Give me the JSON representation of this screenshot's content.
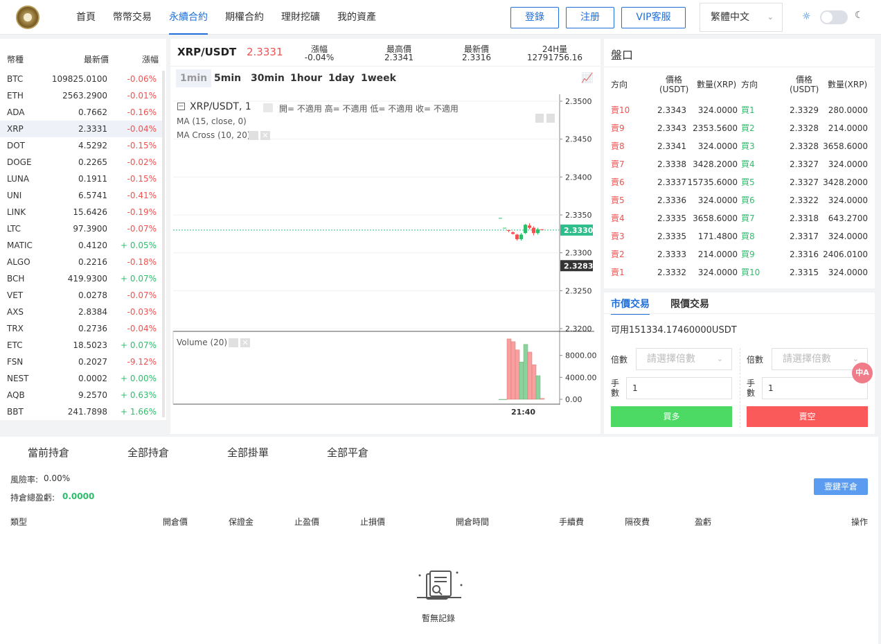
{
  "nav": {
    "items": [
      "首頁",
      "幣幣交易",
      "永續合約",
      "期權合約",
      "理財挖礦",
      "我的資產"
    ],
    "active_index": 2,
    "login": "登錄",
    "register": "注册",
    "vip": "VIP客服",
    "language": "繁體中文"
  },
  "coins": {
    "headers": [
      "幣種",
      "最新價",
      "漲幅"
    ],
    "rows": [
      {
        "sym": "BTC",
        "price": "109825.0100",
        "chg": "-0.06%",
        "dir": "neg"
      },
      {
        "sym": "ETH",
        "price": "2563.2900",
        "chg": "-0.01%",
        "dir": "neg"
      },
      {
        "sym": "ADA",
        "price": "0.7662",
        "chg": "-0.16%",
        "dir": "neg"
      },
      {
        "sym": "XRP",
        "price": "2.3331",
        "chg": "-0.04%",
        "dir": "neg"
      },
      {
        "sym": "DOT",
        "price": "4.5292",
        "chg": "-0.15%",
        "dir": "neg"
      },
      {
        "sym": "DOGE",
        "price": "0.2265",
        "chg": "-0.02%",
        "dir": "neg"
      },
      {
        "sym": "LUNA",
        "price": "0.1911",
        "chg": "-0.15%",
        "dir": "neg"
      },
      {
        "sym": "UNI",
        "price": "6.5741",
        "chg": "-0.41%",
        "dir": "neg"
      },
      {
        "sym": "LINK",
        "price": "15.6426",
        "chg": "-0.19%",
        "dir": "neg"
      },
      {
        "sym": "LTC",
        "price": "97.3900",
        "chg": "-0.07%",
        "dir": "neg"
      },
      {
        "sym": "MATIC",
        "price": "0.4120",
        "chg": "+ 0.05%",
        "dir": "pos"
      },
      {
        "sym": "ALGO",
        "price": "0.2216",
        "chg": "-0.18%",
        "dir": "neg"
      },
      {
        "sym": "BCH",
        "price": "419.9300",
        "chg": "+ 0.07%",
        "dir": "pos"
      },
      {
        "sym": "VET",
        "price": "0.0278",
        "chg": "-0.07%",
        "dir": "neg"
      },
      {
        "sym": "AXS",
        "price": "2.8384",
        "chg": "-0.03%",
        "dir": "neg"
      },
      {
        "sym": "TRX",
        "price": "0.2736",
        "chg": "-0.04%",
        "dir": "neg"
      },
      {
        "sym": "ETC",
        "price": "18.5023",
        "chg": "+ 0.07%",
        "dir": "pos"
      },
      {
        "sym": "FSN",
        "price": "0.2027",
        "chg": "-9.12%",
        "dir": "neg"
      },
      {
        "sym": "NEST",
        "price": "0.0002",
        "chg": "+ 0.00%",
        "dir": "pos"
      },
      {
        "sym": "AQB",
        "price": "9.2570",
        "chg": "+ 0.63%",
        "dir": "pos"
      },
      {
        "sym": "BBT",
        "price": "241.7898",
        "chg": "+ 1.66%",
        "dir": "pos"
      }
    ],
    "selected_index": 3
  },
  "ticker": {
    "pair": "XRP/USDT",
    "price": "2.3331",
    "change_label": "漲幅",
    "change": "-0.04%",
    "high_label": "最高價",
    "high": "2.3341",
    "low_label": "最新價",
    "low": "2.3316",
    "vol_label": "24H量",
    "vol": "12791756.16"
  },
  "timeframes": [
    "1min",
    "5min",
    "30min",
    "1hour",
    "1day",
    "1week"
  ],
  "chart_legend": {
    "title": "XRP/USDT, 1",
    "ohlc": "開= 不適用  高= 不適用  低= 不適用  收= 不適用",
    "ma": "MA (15, close, 0)",
    "ma_cross": "MA Cross (10, 20)",
    "volume": "Volume (20)"
  },
  "chart_data": {
    "type": "candlestick",
    "price_axis": {
      "ticks": [
        "2.3500",
        "2.3450",
        "2.3400",
        "2.3350",
        "2.3300",
        "2.3250",
        "2.3200"
      ]
    },
    "last_price": "2.3330",
    "crosshair_price": "2.3283",
    "volume_axis": {
      "ticks": [
        "8000.00",
        "4000.00",
        "0.00"
      ],
      "ylim": [
        0,
        12000
      ]
    },
    "time_label": "21:40",
    "candles": [
      {
        "o": 2.3346,
        "h": 2.3346,
        "l": 2.3346,
        "c": 2.3346
      },
      {
        "o": 2.3333,
        "h": 2.3333,
        "l": 2.3333,
        "c": 2.3333
      },
      {
        "o": 2.333,
        "h": 2.333,
        "l": 2.3327,
        "c": 2.3329
      },
      {
        "o": 2.3327,
        "h": 2.3328,
        "l": 2.3324,
        "c": 2.3325
      },
      {
        "o": 2.3324,
        "h": 2.3325,
        "l": 2.3316,
        "c": 2.3318
      },
      {
        "o": 2.3318,
        "h": 2.3326,
        "l": 2.3316,
        "c": 2.3324
      },
      {
        "o": 2.3326,
        "h": 2.3338,
        "l": 2.3325,
        "c": 2.3337
      },
      {
        "o": 2.3336,
        "h": 2.3339,
        "l": 2.3331,
        "c": 2.3333
      },
      {
        "o": 2.3333,
        "h": 2.3335,
        "l": 2.3323,
        "c": 2.3326
      },
      {
        "o": 2.3326,
        "h": 2.3333,
        "l": 2.3324,
        "c": 2.3331
      },
      {
        "o": 2.3331,
        "h": 2.3331,
        "l": 2.333,
        "c": 2.333
      }
    ],
    "volumes": [
      0,
      0,
      11000,
      10500,
      9000,
      6800,
      10000,
      8600,
      6300,
      4300,
      150
    ]
  },
  "book": {
    "title": "盤口",
    "headers": {
      "dir": "方向",
      "price": "價格 (USDT)",
      "qty": "數量(XRP)"
    },
    "sells": [
      {
        "label": "賣10",
        "price": "2.3343",
        "qty": "324.0000"
      },
      {
        "label": "賣9",
        "price": "2.3343",
        "qty": "2353.5600"
      },
      {
        "label": "賣8",
        "price": "2.3341",
        "qty": "324.0000"
      },
      {
        "label": "賣7",
        "price": "2.3338",
        "qty": "3428.2000"
      },
      {
        "label": "賣6",
        "price": "2.3337",
        "qty": "15735.6000"
      },
      {
        "label": "賣5",
        "price": "2.3336",
        "qty": "324.0000"
      },
      {
        "label": "賣4",
        "price": "2.3335",
        "qty": "3658.6000"
      },
      {
        "label": "賣3",
        "price": "2.3335",
        "qty": "171.4800"
      },
      {
        "label": "賣2",
        "price": "2.3333",
        "qty": "214.0000"
      },
      {
        "label": "賣1",
        "price": "2.3332",
        "qty": "324.0000"
      }
    ],
    "buys": [
      {
        "label": "買1",
        "price": "2.3329",
        "qty": "280.0000"
      },
      {
        "label": "買2",
        "price": "2.3328",
        "qty": "214.0000"
      },
      {
        "label": "買3",
        "price": "2.3328",
        "qty": "3658.6000"
      },
      {
        "label": "買4",
        "price": "2.3327",
        "qty": "324.0000"
      },
      {
        "label": "買5",
        "price": "2.3327",
        "qty": "3428.2000"
      },
      {
        "label": "買6",
        "price": "2.3322",
        "qty": "324.0000"
      },
      {
        "label": "買7",
        "price": "2.3318",
        "qty": "643.2700"
      },
      {
        "label": "買8",
        "price": "2.3317",
        "qty": "324.0000"
      },
      {
        "label": "買9",
        "price": "2.3316",
        "qty": "2406.0100"
      },
      {
        "label": "買10",
        "price": "2.3315",
        "qty": "324.0000"
      }
    ]
  },
  "trade": {
    "tab_market": "市價交易",
    "tab_limit": "限價交易",
    "available": "可用151334.17460000USDT",
    "leverage_label": "倍數",
    "leverage_placeholder": "請選擇倍數",
    "qty_label": "手數",
    "qty_value": "1",
    "buy_btn": "買多",
    "sell_btn": "賣空"
  },
  "bottom": {
    "tabs": [
      "當前持倉",
      "全部持倉",
      "全部掛單",
      "全部平倉"
    ],
    "risk_label": "風險率:",
    "risk_value": "0.00%",
    "pnl_label": "持倉總盈虧:",
    "pnl_value": "0.0000",
    "close_all": "壹鍵平倉",
    "columns": [
      "類型",
      "開倉價",
      "保證金",
      "止盈價",
      "止損價",
      "開倉時間",
      "手續費",
      "隔夜費",
      "盈虧",
      "操作"
    ],
    "empty_text": "暫無記錄"
  },
  "colors": {
    "accent": "#1e6fd9",
    "up": "#2ebd6b",
    "down": "#f05050"
  }
}
